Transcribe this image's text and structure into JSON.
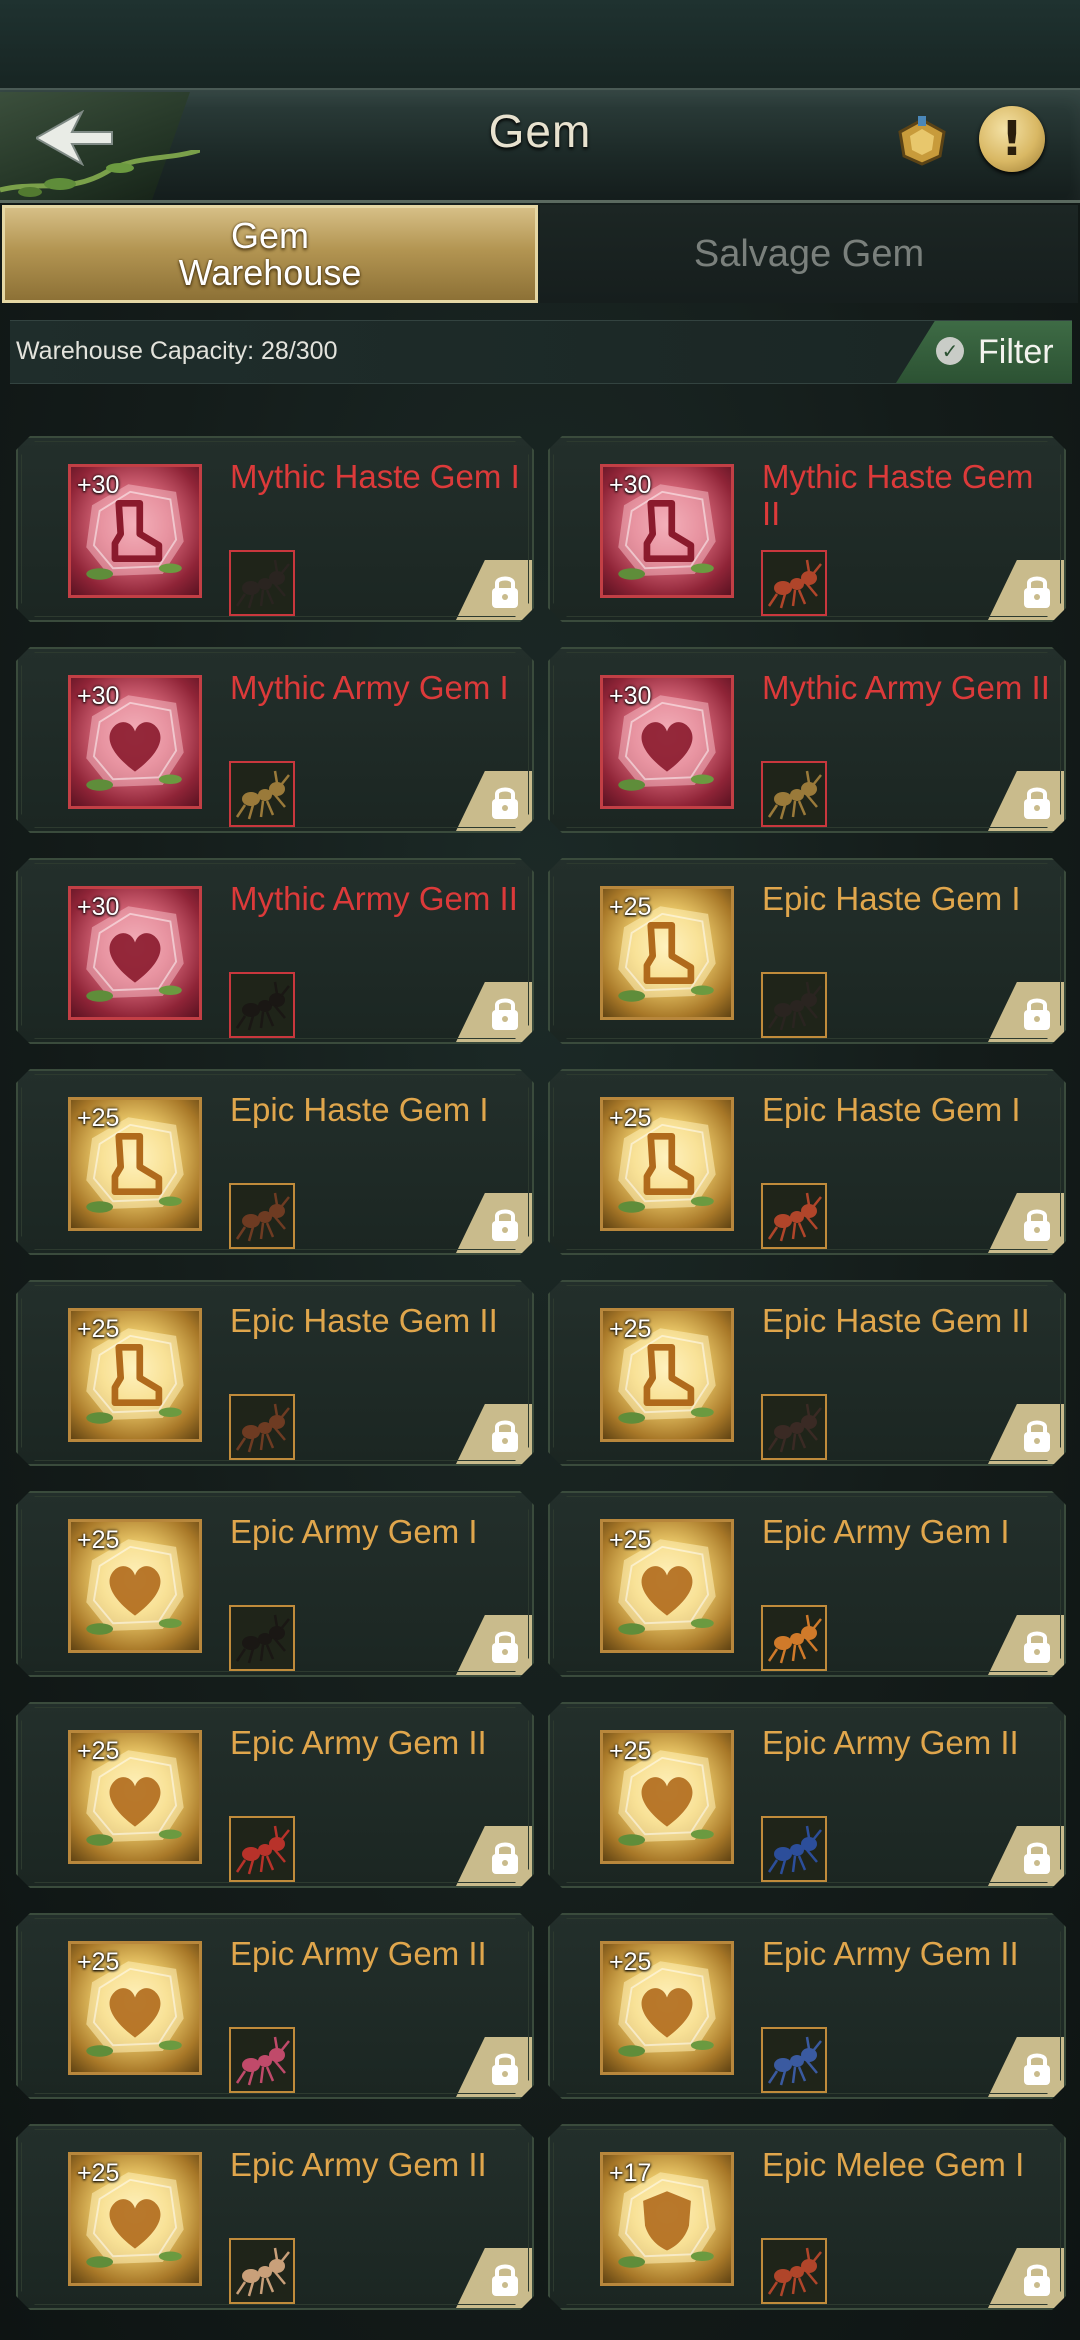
{
  "header": {
    "title": "Gem",
    "back_icon": "back-arrow-icon",
    "rank_icon": "gold-rank-icon",
    "info_label": "!"
  },
  "tabs": [
    {
      "label": "Gem\nWarehouse",
      "active": true
    },
    {
      "label": "Salvage Gem",
      "active": false
    }
  ],
  "capacity": {
    "text": "Warehouse Capacity: 28/300"
  },
  "filter": {
    "label": "Filter"
  },
  "colors": {
    "mythic": "#dc3a3a",
    "epic": "#e0a64c",
    "filter_green": "#3e6b45",
    "tab_gold": "#b39552"
  },
  "gems": [
    {
      "level": "+30",
      "name": "Mythic Haste Gem I",
      "rarity": "mythic",
      "symbol": "boot",
      "unit": "black-ant"
    },
    {
      "level": "+30",
      "name": "Mythic Haste Gem II",
      "rarity": "mythic",
      "symbol": "boot",
      "unit": "red-ant"
    },
    {
      "level": "+30",
      "name": "Mythic Army Gem I",
      "rarity": "mythic",
      "symbol": "heart",
      "unit": "gold-mantis"
    },
    {
      "level": "+30",
      "name": "Mythic Army Gem II",
      "rarity": "mythic",
      "symbol": "heart",
      "unit": "gold-mantis"
    },
    {
      "level": "+30",
      "name": "Mythic Army Gem II",
      "rarity": "mythic",
      "symbol": "heart",
      "unit": "black-beetle"
    },
    {
      "level": "+25",
      "name": "Epic Haste Gem I",
      "rarity": "epic",
      "symbol": "boot",
      "unit": "black-ant"
    },
    {
      "level": "+25",
      "name": "Epic Haste Gem I",
      "rarity": "epic",
      "symbol": "boot",
      "unit": "brown-ant"
    },
    {
      "level": "+25",
      "name": "Epic Haste Gem I",
      "rarity": "epic",
      "symbol": "boot",
      "unit": "red-ant"
    },
    {
      "level": "+25",
      "name": "Epic Haste Gem II",
      "rarity": "epic",
      "symbol": "boot",
      "unit": "brown-ant"
    },
    {
      "level": "+25",
      "name": "Epic Haste Gem II",
      "rarity": "epic",
      "symbol": "boot",
      "unit": "dark-ant"
    },
    {
      "level": "+25",
      "name": "Epic Army Gem I",
      "rarity": "epic",
      "symbol": "heart",
      "unit": "black-beetle"
    },
    {
      "level": "+25",
      "name": "Epic Army Gem I",
      "rarity": "epic",
      "symbol": "heart",
      "unit": "orange-ant"
    },
    {
      "level": "+25",
      "name": "Epic Army Gem II",
      "rarity": "epic",
      "symbol": "heart",
      "unit": "red-larva"
    },
    {
      "level": "+25",
      "name": "Epic Army Gem II",
      "rarity": "epic",
      "symbol": "heart",
      "unit": "blue-ant"
    },
    {
      "level": "+25",
      "name": "Epic Army Gem II",
      "rarity": "epic",
      "symbol": "heart",
      "unit": "spider"
    },
    {
      "level": "+25",
      "name": "Epic Army Gem II",
      "rarity": "epic",
      "symbol": "heart",
      "unit": "blue-mantis"
    },
    {
      "level": "+25",
      "name": "Epic Army Gem II",
      "rarity": "epic",
      "symbol": "heart",
      "unit": "pale-ant"
    },
    {
      "level": "+17",
      "name": "Epic Melee Gem I",
      "rarity": "epic",
      "symbol": "shield",
      "unit": "red-ant"
    }
  ]
}
